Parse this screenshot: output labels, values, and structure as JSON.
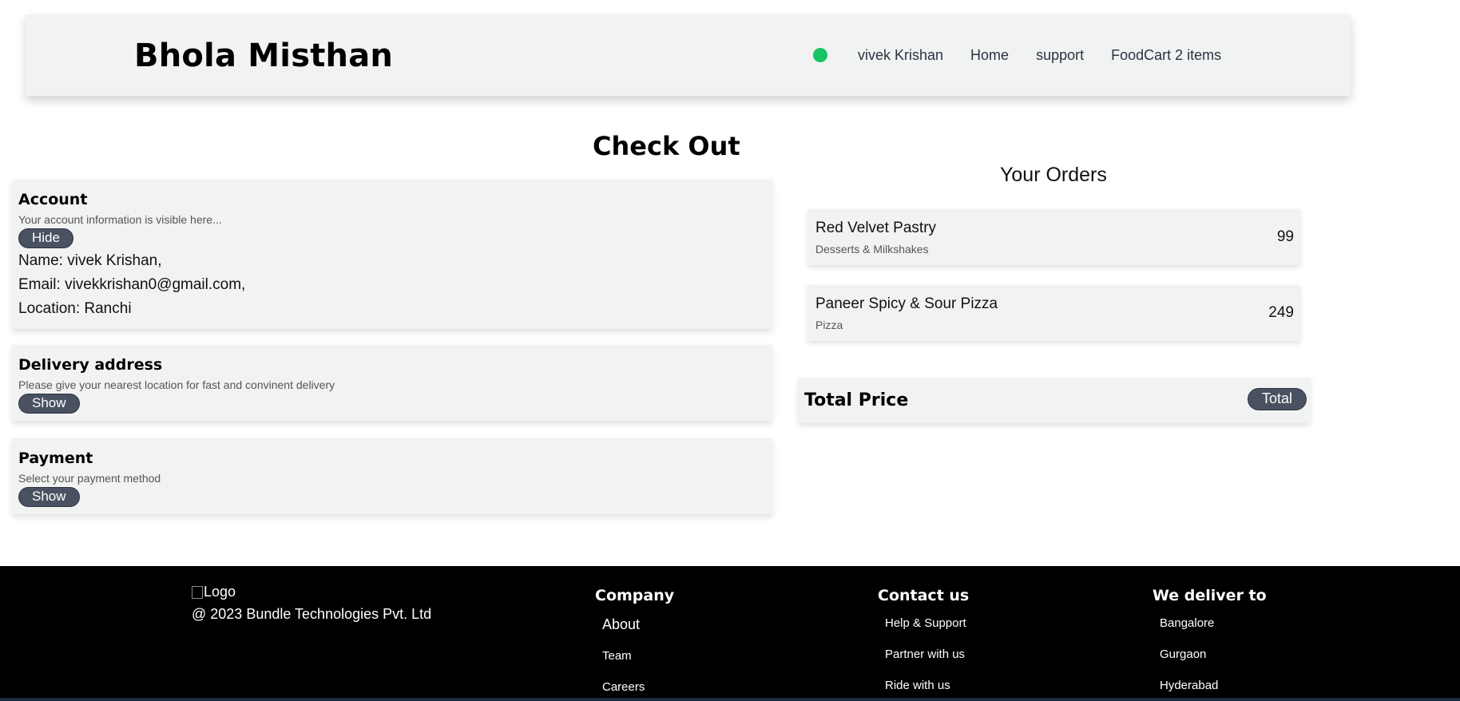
{
  "header": {
    "brand": "Bhola Misthan",
    "status_color": "#19c466",
    "nav": [
      "vivek Krishan",
      "Home",
      "support",
      "FoodCart 2 items"
    ]
  },
  "checkout": {
    "title": "Check Out",
    "account": {
      "title": "Account",
      "subtitle": "Your account information is visible here...",
      "button": "Hide",
      "name": "Name: vivek Krishan,",
      "email": "Email: vivekkrishan0@gmail.com,",
      "location": "Location: Ranchi"
    },
    "delivery": {
      "title": "Delivery address",
      "subtitle": "Please give your nearest location for fast and convinent delivery",
      "button": "Show"
    },
    "payment": {
      "title": "Payment",
      "subtitle": "Select your payment method",
      "button": "Show"
    }
  },
  "orders": {
    "title": "Your Orders",
    "items": [
      {
        "name": "Red Velvet Pastry",
        "category": "Desserts & Milkshakes",
        "price": "99"
      },
      {
        "name": "Paneer Spicy & Sour Pizza",
        "category": "Pizza",
        "price": "249"
      }
    ],
    "total_label": "Total Price",
    "total_button": "Total"
  },
  "footer": {
    "logo_alt": "Logo",
    "copyright": "@ 2023 Bundle Technologies Pvt. Ltd",
    "company": {
      "title": "Company",
      "links": [
        "About",
        "Team",
        "Careers"
      ]
    },
    "contact": {
      "title": "Contact us",
      "links": [
        "Help & Support",
        "Partner with us",
        "Ride with us"
      ]
    },
    "deliver": {
      "title": "We deliver to",
      "links": [
        "Bangalore",
        "Gurgaon",
        "Hyderabad"
      ]
    }
  },
  "colors": {
    "accent_button": "#4a5262",
    "footer_bg": "#000000",
    "card_bg": "#f1f2f2"
  }
}
